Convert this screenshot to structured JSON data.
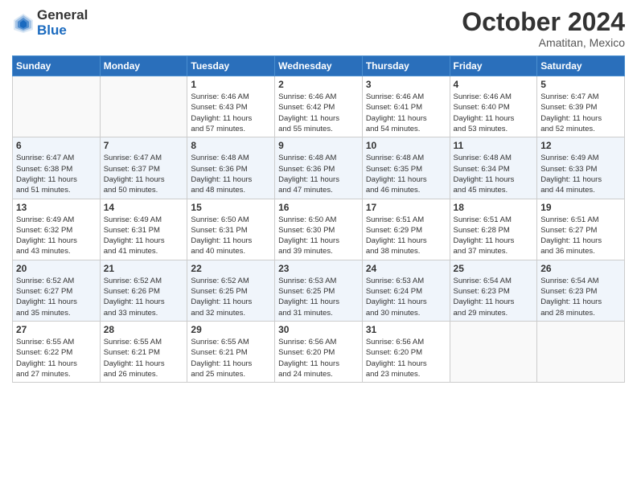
{
  "logo": {
    "general": "General",
    "blue": "Blue"
  },
  "header": {
    "month": "October 2024",
    "location": "Amatitan, Mexico"
  },
  "weekdays": [
    "Sunday",
    "Monday",
    "Tuesday",
    "Wednesday",
    "Thursday",
    "Friday",
    "Saturday"
  ],
  "weeks": [
    [
      {
        "day": "",
        "info": ""
      },
      {
        "day": "",
        "info": ""
      },
      {
        "day": "1",
        "info": "Sunrise: 6:46 AM\nSunset: 6:43 PM\nDaylight: 11 hours\nand 57 minutes."
      },
      {
        "day": "2",
        "info": "Sunrise: 6:46 AM\nSunset: 6:42 PM\nDaylight: 11 hours\nand 55 minutes."
      },
      {
        "day": "3",
        "info": "Sunrise: 6:46 AM\nSunset: 6:41 PM\nDaylight: 11 hours\nand 54 minutes."
      },
      {
        "day": "4",
        "info": "Sunrise: 6:46 AM\nSunset: 6:40 PM\nDaylight: 11 hours\nand 53 minutes."
      },
      {
        "day": "5",
        "info": "Sunrise: 6:47 AM\nSunset: 6:39 PM\nDaylight: 11 hours\nand 52 minutes."
      }
    ],
    [
      {
        "day": "6",
        "info": "Sunrise: 6:47 AM\nSunset: 6:38 PM\nDaylight: 11 hours\nand 51 minutes."
      },
      {
        "day": "7",
        "info": "Sunrise: 6:47 AM\nSunset: 6:37 PM\nDaylight: 11 hours\nand 50 minutes."
      },
      {
        "day": "8",
        "info": "Sunrise: 6:48 AM\nSunset: 6:36 PM\nDaylight: 11 hours\nand 48 minutes."
      },
      {
        "day": "9",
        "info": "Sunrise: 6:48 AM\nSunset: 6:36 PM\nDaylight: 11 hours\nand 47 minutes."
      },
      {
        "day": "10",
        "info": "Sunrise: 6:48 AM\nSunset: 6:35 PM\nDaylight: 11 hours\nand 46 minutes."
      },
      {
        "day": "11",
        "info": "Sunrise: 6:48 AM\nSunset: 6:34 PM\nDaylight: 11 hours\nand 45 minutes."
      },
      {
        "day": "12",
        "info": "Sunrise: 6:49 AM\nSunset: 6:33 PM\nDaylight: 11 hours\nand 44 minutes."
      }
    ],
    [
      {
        "day": "13",
        "info": "Sunrise: 6:49 AM\nSunset: 6:32 PM\nDaylight: 11 hours\nand 43 minutes."
      },
      {
        "day": "14",
        "info": "Sunrise: 6:49 AM\nSunset: 6:31 PM\nDaylight: 11 hours\nand 41 minutes."
      },
      {
        "day": "15",
        "info": "Sunrise: 6:50 AM\nSunset: 6:31 PM\nDaylight: 11 hours\nand 40 minutes."
      },
      {
        "day": "16",
        "info": "Sunrise: 6:50 AM\nSunset: 6:30 PM\nDaylight: 11 hours\nand 39 minutes."
      },
      {
        "day": "17",
        "info": "Sunrise: 6:51 AM\nSunset: 6:29 PM\nDaylight: 11 hours\nand 38 minutes."
      },
      {
        "day": "18",
        "info": "Sunrise: 6:51 AM\nSunset: 6:28 PM\nDaylight: 11 hours\nand 37 minutes."
      },
      {
        "day": "19",
        "info": "Sunrise: 6:51 AM\nSunset: 6:27 PM\nDaylight: 11 hours\nand 36 minutes."
      }
    ],
    [
      {
        "day": "20",
        "info": "Sunrise: 6:52 AM\nSunset: 6:27 PM\nDaylight: 11 hours\nand 35 minutes."
      },
      {
        "day": "21",
        "info": "Sunrise: 6:52 AM\nSunset: 6:26 PM\nDaylight: 11 hours\nand 33 minutes."
      },
      {
        "day": "22",
        "info": "Sunrise: 6:52 AM\nSunset: 6:25 PM\nDaylight: 11 hours\nand 32 minutes."
      },
      {
        "day": "23",
        "info": "Sunrise: 6:53 AM\nSunset: 6:25 PM\nDaylight: 11 hours\nand 31 minutes."
      },
      {
        "day": "24",
        "info": "Sunrise: 6:53 AM\nSunset: 6:24 PM\nDaylight: 11 hours\nand 30 minutes."
      },
      {
        "day": "25",
        "info": "Sunrise: 6:54 AM\nSunset: 6:23 PM\nDaylight: 11 hours\nand 29 minutes."
      },
      {
        "day": "26",
        "info": "Sunrise: 6:54 AM\nSunset: 6:23 PM\nDaylight: 11 hours\nand 28 minutes."
      }
    ],
    [
      {
        "day": "27",
        "info": "Sunrise: 6:55 AM\nSunset: 6:22 PM\nDaylight: 11 hours\nand 27 minutes."
      },
      {
        "day": "28",
        "info": "Sunrise: 6:55 AM\nSunset: 6:21 PM\nDaylight: 11 hours\nand 26 minutes."
      },
      {
        "day": "29",
        "info": "Sunrise: 6:55 AM\nSunset: 6:21 PM\nDaylight: 11 hours\nand 25 minutes."
      },
      {
        "day": "30",
        "info": "Sunrise: 6:56 AM\nSunset: 6:20 PM\nDaylight: 11 hours\nand 24 minutes."
      },
      {
        "day": "31",
        "info": "Sunrise: 6:56 AM\nSunset: 6:20 PM\nDaylight: 11 hours\nand 23 minutes."
      },
      {
        "day": "",
        "info": ""
      },
      {
        "day": "",
        "info": ""
      }
    ]
  ]
}
